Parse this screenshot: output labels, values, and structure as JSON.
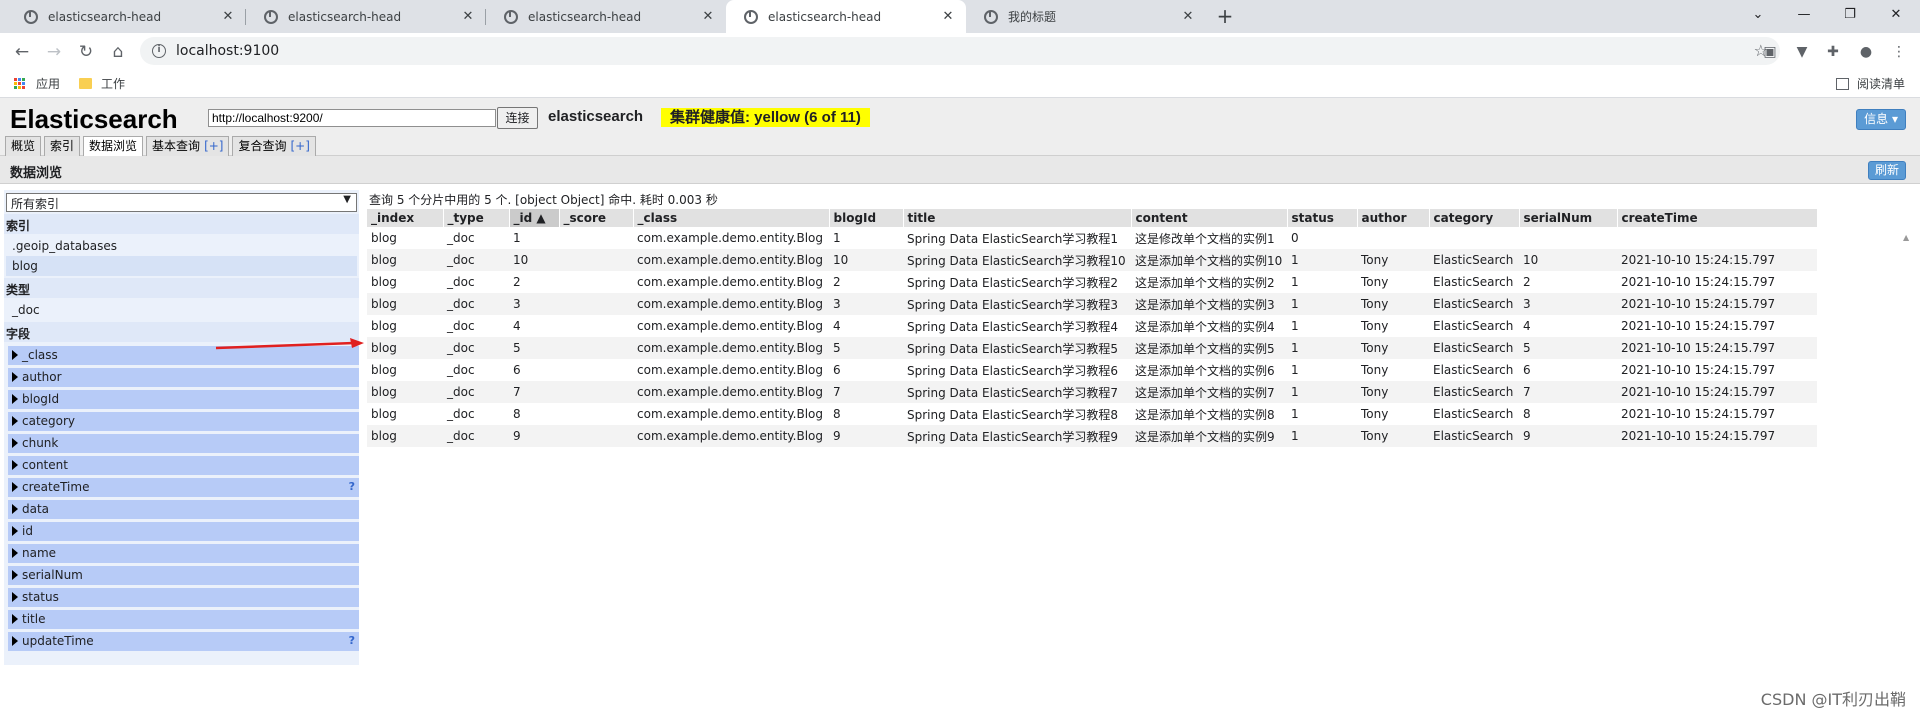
{
  "browser": {
    "tabs": [
      {
        "title": "elasticsearch-head",
        "active": false
      },
      {
        "title": "elasticsearch-head",
        "active": false
      },
      {
        "title": "elasticsearch-head",
        "active": false
      },
      {
        "title": "elasticsearch-head",
        "active": true
      },
      {
        "title": "我的标题",
        "active": false
      }
    ],
    "url": "localhost:9100",
    "bookmarks": [
      {
        "label": "应用",
        "icon": "apps-icon"
      },
      {
        "label": "工作",
        "icon": "folder-icon"
      }
    ],
    "reading_list": "阅读清单"
  },
  "app": {
    "logo": "Elasticsearch",
    "cluster_url": "http://localhost:9200/",
    "connect_label": "连接",
    "cluster_name": "elasticsearch",
    "health": "集群健康值: yellow (6 of 11)",
    "health_color": "#ffff00",
    "info_label": "信息 ▾",
    "tabs": [
      {
        "label": "概览",
        "plus": ""
      },
      {
        "label": "索引",
        "plus": ""
      },
      {
        "label": "数据浏览",
        "plus": ""
      },
      {
        "label": "基本查询",
        "plus": "[+]"
      },
      {
        "label": "复合查询",
        "plus": "[+]"
      }
    ],
    "active_tab": "数据浏览",
    "section_title": "数据浏览",
    "refresh_label": "刷新"
  },
  "sidebar": {
    "select_value": "所有索引",
    "index_header": "索引",
    "indices": [
      ".geoip_databases",
      "blog"
    ],
    "selected_index": "blog",
    "type_header": "类型",
    "types": [
      "_doc"
    ],
    "field_header": "字段",
    "fields": [
      {
        "name": "_class",
        "help": ""
      },
      {
        "name": "author",
        "help": ""
      },
      {
        "name": "blogId",
        "help": ""
      },
      {
        "name": "category",
        "help": ""
      },
      {
        "name": "chunk",
        "help": ""
      },
      {
        "name": "content",
        "help": ""
      },
      {
        "name": "createTime",
        "help": "?"
      },
      {
        "name": "data",
        "help": ""
      },
      {
        "name": "id",
        "help": ""
      },
      {
        "name": "name",
        "help": ""
      },
      {
        "name": "serialNum",
        "help": ""
      },
      {
        "name": "status",
        "help": ""
      },
      {
        "name": "title",
        "help": ""
      },
      {
        "name": "updateTime",
        "help": "?"
      }
    ]
  },
  "results": {
    "summary": "查询 5 个分片中用的 5 个. [object Object] 命中. 耗时 0.003 秒",
    "columns": [
      "_index",
      "_type",
      "_id ▲",
      "_score",
      "_class",
      "blogId",
      "title",
      "content",
      "status",
      "author",
      "category",
      "serialNum",
      "createTime"
    ],
    "rows": [
      [
        "blog",
        "_doc",
        "1",
        "",
        "com.example.demo.entity.Blog",
        "1",
        "Spring Data ElasticSearch学习教程1",
        "这是修改单个文档的实例1",
        "0",
        "",
        "",
        "",
        ""
      ],
      [
        "blog",
        "_doc",
        "10",
        "",
        "com.example.demo.entity.Blog",
        "10",
        "Spring Data ElasticSearch学习教程10",
        "这是添加单个文档的实例10",
        "1",
        "Tony",
        "ElasticSearch",
        "10",
        "2021-10-10 15:24:15.797"
      ],
      [
        "blog",
        "_doc",
        "2",
        "",
        "com.example.demo.entity.Blog",
        "2",
        "Spring Data ElasticSearch学习教程2",
        "这是添加单个文档的实例2",
        "1",
        "Tony",
        "ElasticSearch",
        "2",
        "2021-10-10 15:24:15.797"
      ],
      [
        "blog",
        "_doc",
        "3",
        "",
        "com.example.demo.entity.Blog",
        "3",
        "Spring Data ElasticSearch学习教程3",
        "这是添加单个文档的实例3",
        "1",
        "Tony",
        "ElasticSearch",
        "3",
        "2021-10-10 15:24:15.797"
      ],
      [
        "blog",
        "_doc",
        "4",
        "",
        "com.example.demo.entity.Blog",
        "4",
        "Spring Data ElasticSearch学习教程4",
        "这是添加单个文档的实例4",
        "1",
        "Tony",
        "ElasticSearch",
        "4",
        "2021-10-10 15:24:15.797"
      ],
      [
        "blog",
        "_doc",
        "5",
        "",
        "com.example.demo.entity.Blog",
        "5",
        "Spring Data ElasticSearch学习教程5",
        "这是添加单个文档的实例5",
        "1",
        "Tony",
        "ElasticSearch",
        "5",
        "2021-10-10 15:24:15.797"
      ],
      [
        "blog",
        "_doc",
        "6",
        "",
        "com.example.demo.entity.Blog",
        "6",
        "Spring Data ElasticSearch学习教程6",
        "这是添加单个文档的实例6",
        "1",
        "Tony",
        "ElasticSearch",
        "6",
        "2021-10-10 15:24:15.797"
      ],
      [
        "blog",
        "_doc",
        "7",
        "",
        "com.example.demo.entity.Blog",
        "7",
        "Spring Data ElasticSearch学习教程7",
        "这是添加单个文档的实例7",
        "1",
        "Tony",
        "ElasticSearch",
        "7",
        "2021-10-10 15:24:15.797"
      ],
      [
        "blog",
        "_doc",
        "8",
        "",
        "com.example.demo.entity.Blog",
        "8",
        "Spring Data ElasticSearch学习教程8",
        "这是添加单个文档的实例8",
        "1",
        "Tony",
        "ElasticSearch",
        "8",
        "2021-10-10 15:24:15.797"
      ],
      [
        "blog",
        "_doc",
        "9",
        "",
        "com.example.demo.entity.Blog",
        "9",
        "Spring Data ElasticSearch学习教程9",
        "这是添加单个文档的实例9",
        "1",
        "Tony",
        "ElasticSearch",
        "9",
        "2021-10-10 15:24:15.797"
      ]
    ]
  },
  "watermark": "CSDN @IT利刃出鞘",
  "colors": {
    "accent": "#5b9bd5",
    "field_bg": "#b7cbf7",
    "annotation_arrow": "#e02020"
  }
}
